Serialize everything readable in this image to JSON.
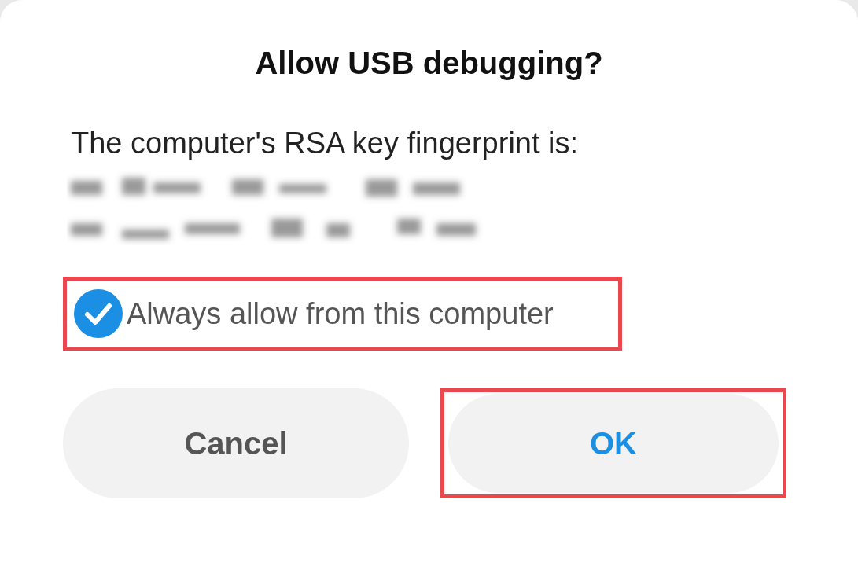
{
  "dialog": {
    "title": "Allow USB debugging?",
    "message": "The computer's RSA key fingerprint is:",
    "fingerprint": {
      "kind": "redacted"
    },
    "checkbox": {
      "label": "Always allow from this computer",
      "checked": true,
      "highlighted": true
    },
    "buttons": [
      {
        "label": "Cancel",
        "kind": "neutral",
        "highlighted": false
      },
      {
        "label": "OK",
        "kind": "primary",
        "highlighted": true
      }
    ]
  }
}
